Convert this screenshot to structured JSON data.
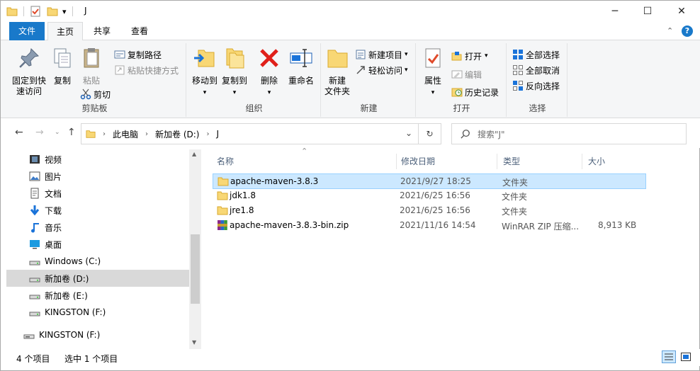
{
  "window": {
    "title": "J",
    "controls": {
      "minimize": "─",
      "maximize": "☐",
      "close": "✕"
    }
  },
  "quick_access": {
    "dropdown": "▾"
  },
  "tabs": [
    {
      "label": "文件"
    },
    {
      "label": "主页"
    },
    {
      "label": "共享"
    },
    {
      "label": "查看"
    }
  ],
  "ribbon": {
    "help": "?",
    "clipboard": {
      "label": "剪贴板",
      "pin": "固定到快\n速访问",
      "copy": "复制",
      "paste": "粘贴",
      "copy_path": "复制路径",
      "paste_shortcut": "粘贴快捷方式",
      "cut": "剪切"
    },
    "organize": {
      "label": "组织",
      "move_to": "移动到",
      "copy_to": "复制到",
      "delete": "删除",
      "rename": "重命名"
    },
    "new": {
      "label": "新建",
      "new_folder": "新建\n文件夹",
      "new_item": "新建项目",
      "easy_access": "轻松访问"
    },
    "open": {
      "label": "打开",
      "properties": "属性",
      "open": "打开",
      "edit": "编辑",
      "history": "历史记录"
    },
    "select": {
      "label": "选择",
      "select_all": "全部选择",
      "select_none": "全部取消",
      "invert": "反向选择"
    }
  },
  "address": {
    "parts": [
      "此电脑",
      "新加卷 (D:)",
      "J"
    ],
    "search_placeholder": "搜索\"J\""
  },
  "nav": [
    {
      "label": "视频",
      "icon": "video-icon"
    },
    {
      "label": "图片",
      "icon": "picture-icon"
    },
    {
      "label": "文档",
      "icon": "document-icon"
    },
    {
      "label": "下载",
      "icon": "download-icon"
    },
    {
      "label": "音乐",
      "icon": "music-icon"
    },
    {
      "label": "桌面",
      "icon": "desktop-icon"
    },
    {
      "label": "Windows (C:)",
      "icon": "drive-icon"
    },
    {
      "label": "新加卷 (D:)",
      "icon": "drive-icon",
      "selected": true
    },
    {
      "label": "新加卷 (E:)",
      "icon": "drive-icon"
    },
    {
      "label": "KINGSTON (F:)",
      "icon": "drive-icon"
    },
    {
      "label": "KINGSTON (F:)",
      "icon": "usb-drive-icon"
    }
  ],
  "columns": {
    "name": "名称",
    "modified": "修改日期",
    "type": "类型",
    "size": "大小"
  },
  "files": [
    {
      "name": "apache-maven-3.8.3",
      "modified": "2021/9/27 18:25",
      "type": "文件夹",
      "size": "",
      "icon": "folder-icon",
      "selected": true
    },
    {
      "name": "jdk1.8",
      "modified": "2021/6/25 16:56",
      "type": "文件夹",
      "size": "",
      "icon": "folder-icon"
    },
    {
      "name": "jre1.8",
      "modified": "2021/6/25 16:56",
      "type": "文件夹",
      "size": "",
      "icon": "folder-icon"
    },
    {
      "name": "apache-maven-3.8.3-bin.zip",
      "modified": "2021/11/16 14:54",
      "type": "WinRAR ZIP 压缩...",
      "size": "8,913 KB",
      "icon": "winrar-zip-icon"
    }
  ],
  "status": {
    "count": "4 个项目",
    "selected": "选中 1 个项目"
  }
}
